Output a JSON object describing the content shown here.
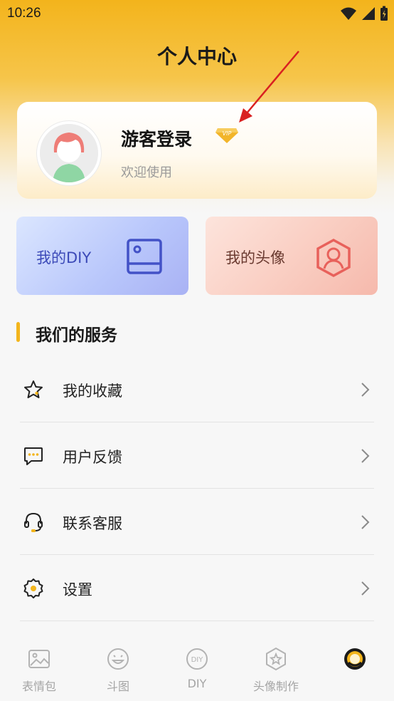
{
  "status_bar": {
    "time": "10:26",
    "icons": [
      "wifi-icon",
      "signal-icon",
      "battery-icon"
    ]
  },
  "header": {
    "title": "个人中心"
  },
  "profile": {
    "username": "游客登录",
    "badge": "VIP",
    "subtitle": "欢迎使用"
  },
  "quick_actions": [
    {
      "label": "我的DIY",
      "icon": "diy-box-icon"
    },
    {
      "label": "我的头像",
      "icon": "avatar-hexagon-icon"
    }
  ],
  "services": {
    "title": "我们的服务",
    "items": [
      {
        "label": "我的收藏",
        "icon": "star-icon"
      },
      {
        "label": "用户反馈",
        "icon": "feedback-chat-icon"
      },
      {
        "label": "联系客服",
        "icon": "headset-icon"
      },
      {
        "label": "设置",
        "icon": "gear-icon"
      }
    ]
  },
  "tabbar": {
    "items": [
      {
        "label": "表情包",
        "icon": "image-icon",
        "active": false
      },
      {
        "label": "斗图",
        "icon": "smile-icon",
        "active": false
      },
      {
        "label": "DIY",
        "icon": "diy-circle-icon",
        "active": false
      },
      {
        "label": "头像制作",
        "icon": "star-hexagon-icon",
        "active": false
      },
      {
        "label": "",
        "icon": "profile-tab-icon",
        "active": true
      }
    ]
  },
  "colors": {
    "accent": "#f3b51c",
    "header_top": "#f3b41c",
    "diy_text": "#3c4ab8",
    "avatar_text": "#6a3a30",
    "annotation_arrow": "#d92121"
  }
}
